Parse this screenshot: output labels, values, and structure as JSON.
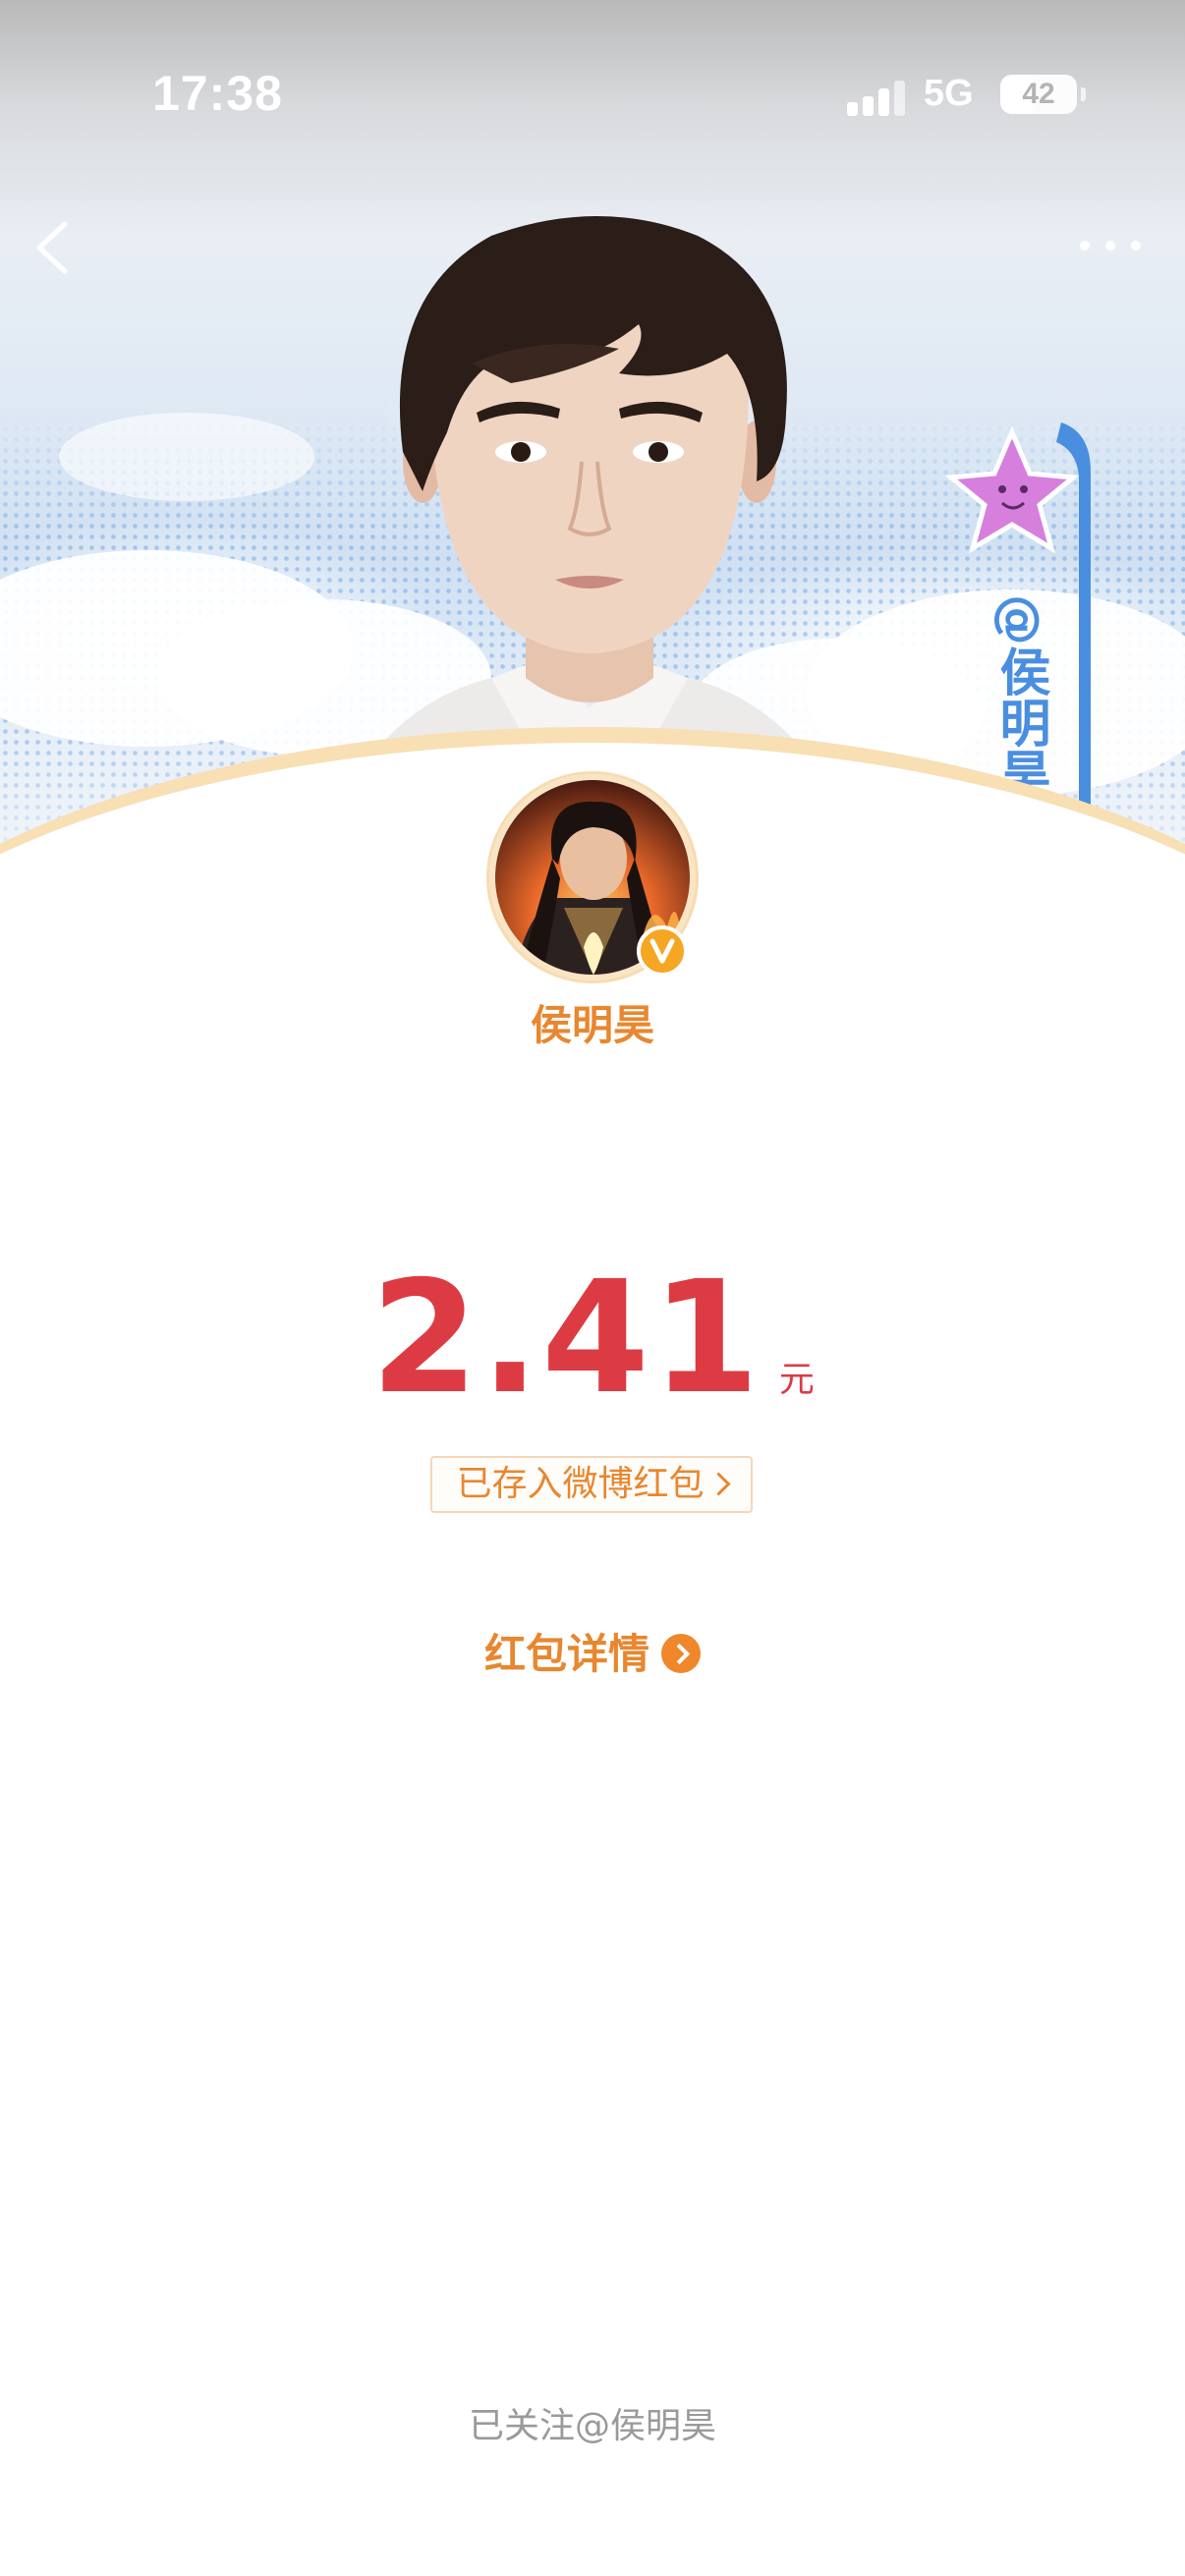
{
  "status_bar": {
    "time": "17:38",
    "network": "5G",
    "battery": "42",
    "battery_level": 0.42
  },
  "header": {
    "back_icon": "chevron-left-icon",
    "more_icon": "more-horizontal-icon",
    "sticker_text": "@侯明昊"
  },
  "profile": {
    "name": "侯明昊",
    "badge_icon": "vip-verified-icon"
  },
  "red_packet": {
    "amount": "2.41",
    "unit": "元",
    "stored_label": "已存入微博红包",
    "detail_label": "红包详情"
  },
  "footer": {
    "followed_text": "已关注@侯明昊"
  },
  "colors": {
    "accent_orange": "#e8872f",
    "amount_red": "#dd3b44",
    "muted_gray": "#9a9a9a"
  }
}
